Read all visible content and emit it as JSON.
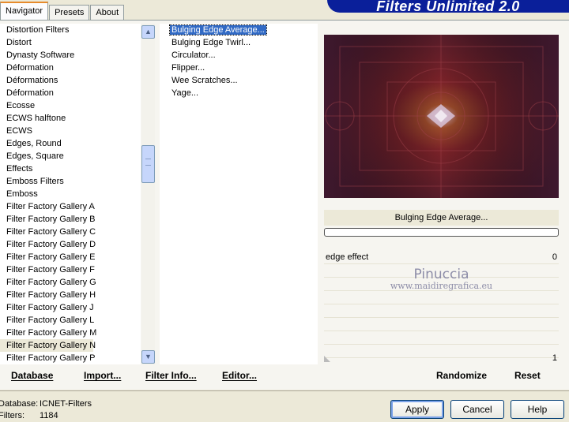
{
  "tabs": [
    "Navigator",
    "Presets",
    "About"
  ],
  "banner": "Filters Unlimited 2.0",
  "categories": [
    "Distortion Filters",
    "Distort",
    "Dynasty Software",
    "Déformation",
    "Déformations",
    "Déformation",
    "Ecosse",
    "ECWS halftone",
    "ECWS",
    "Edges, Round",
    "Edges, Square",
    "Effects",
    "Emboss Filters",
    "Emboss",
    "Filter Factory Gallery A",
    "Filter Factory Gallery B",
    "Filter Factory Gallery C",
    "Filter Factory Gallery D",
    "Filter Factory Gallery E",
    "Filter Factory Gallery F",
    "Filter Factory Gallery G",
    "Filter Factory Gallery H",
    "Filter Factory Gallery J",
    "Filter Factory Gallery L",
    "Filter Factory Gallery M",
    "Filter Factory Gallery N",
    "Filter Factory Gallery P"
  ],
  "selected_category": "Filter Factory Gallery N",
  "filters": [
    "Bulging Edge Average...",
    "Bulging Edge Twirl...",
    "Circulator...",
    "Flipper...",
    "Wee Scratches...",
    "Yage..."
  ],
  "selected_filter": "Bulging Edge Average...",
  "preview": {
    "filter_name": "Bulging Edge Average...",
    "progress": 0
  },
  "params": [
    {
      "label": "edge effect",
      "value": "0"
    }
  ],
  "watermark": {
    "line1": "Pinuccia",
    "line2": "www.maidiregrafica.eu"
  },
  "slider_value": "1",
  "toolbar": {
    "database": "Database",
    "import": "Import...",
    "filter_info": "Filter Info...",
    "editor": "Editor...",
    "randomize": "Randomize",
    "reset": "Reset"
  },
  "stats": {
    "database_label": "Database:",
    "database_value": "ICNET-Filters",
    "filters_label": "Filters:",
    "filters_value": "1184"
  },
  "buttons": {
    "apply": "Apply",
    "cancel": "Cancel",
    "help": "Help"
  },
  "colors": {
    "banner": "#0a1f9a",
    "selection": "#316ac5",
    "tab_accent": "#e68b2c"
  }
}
